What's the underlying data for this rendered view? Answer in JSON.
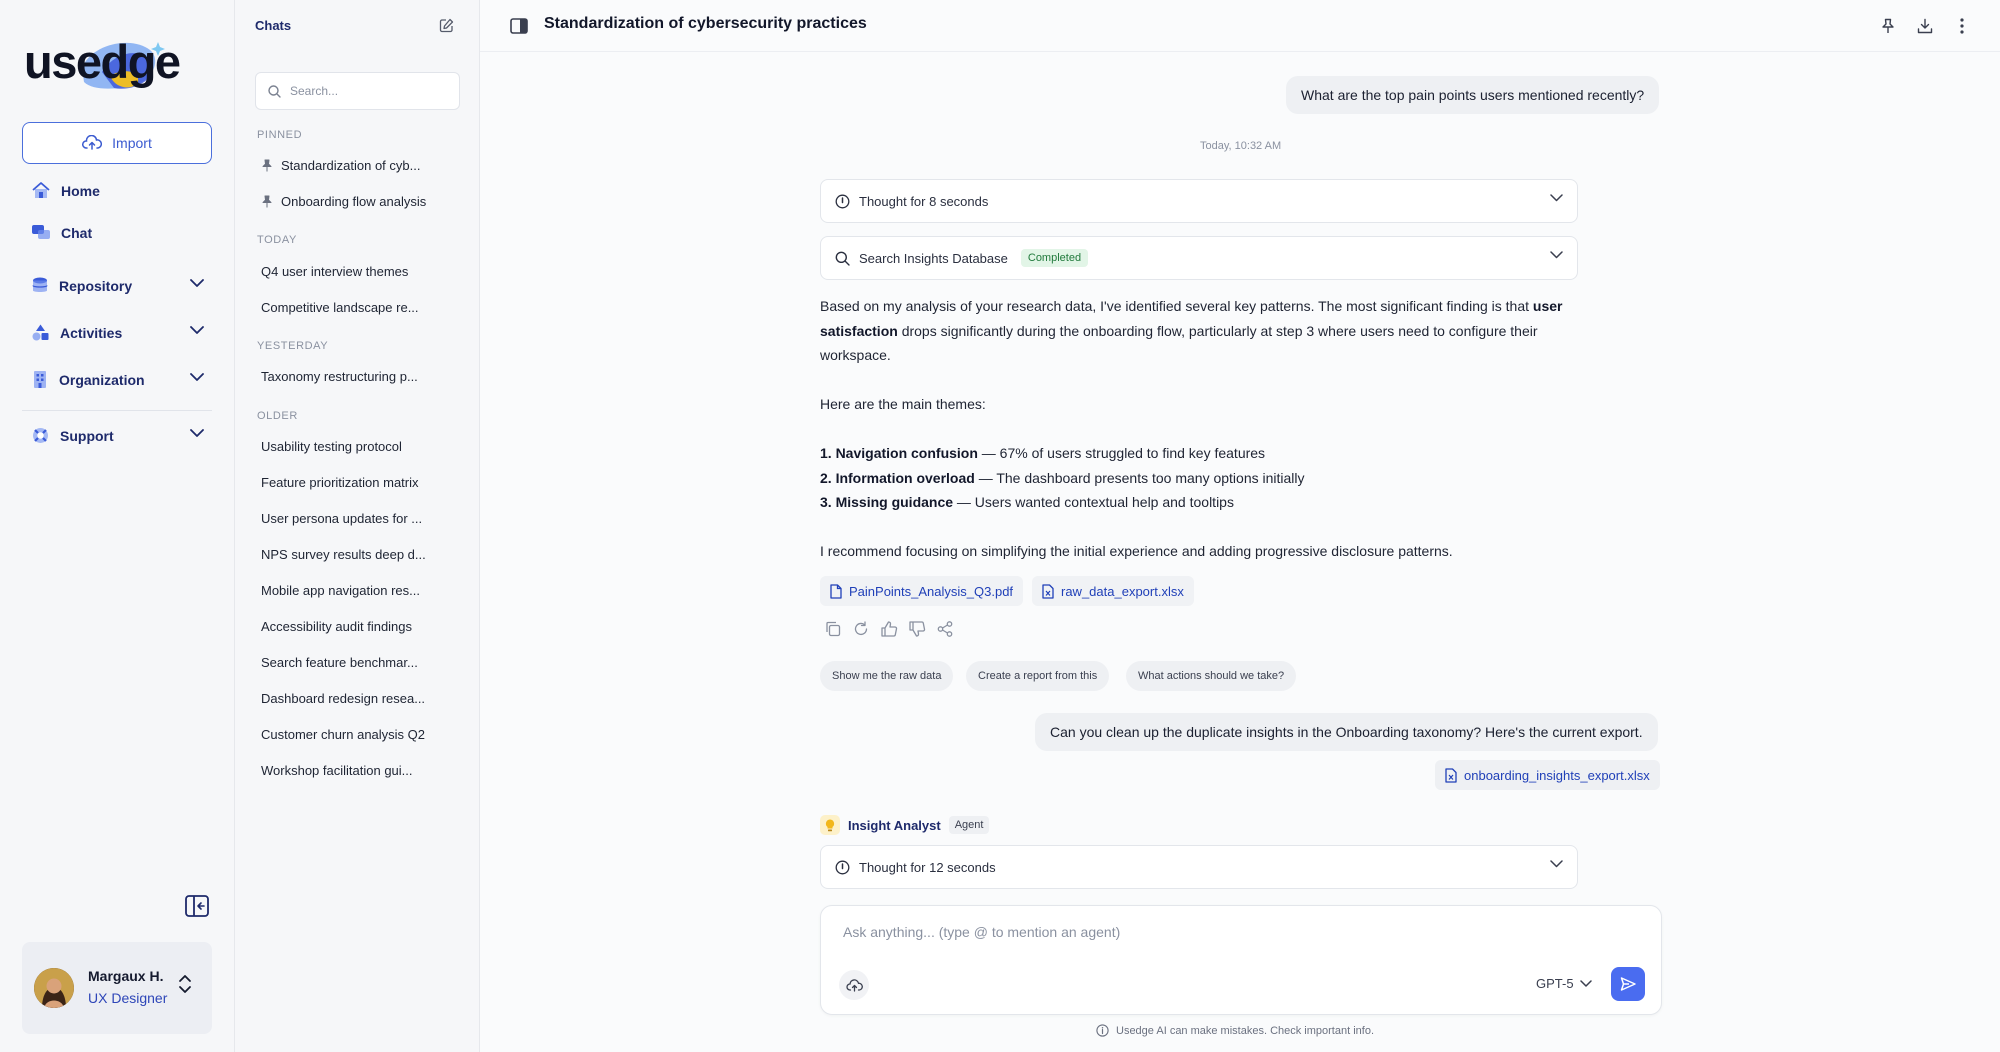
{
  "brand": {
    "logo_text": "usedge"
  },
  "nav": {
    "import_label": "Import",
    "items": [
      {
        "label": "Home",
        "icon": "home-icon"
      },
      {
        "label": "Chat",
        "icon": "chat-icon"
      },
      {
        "label": "Repository",
        "icon": "database-icon"
      },
      {
        "label": "Activities",
        "icon": "shapes-icon"
      },
      {
        "label": "Organization",
        "icon": "building-icon"
      },
      {
        "label": "Support",
        "icon": "lifebuoy-icon"
      }
    ]
  },
  "user": {
    "name": "Margaux H.",
    "role": "UX Designer"
  },
  "chats": {
    "title": "Chats",
    "search_placeholder": "Search...",
    "sections": {
      "pinned": "PINNED",
      "today": "TODAY",
      "yesterday": "YESTERDAY",
      "older": "OLDER"
    },
    "pinned": [
      "Standardization of cyb...",
      "Onboarding flow analysis"
    ],
    "today": [
      "Q4 user interview themes",
      "Competitive landscape re..."
    ],
    "yesterday": [
      "Taxonomy restructuring p..."
    ],
    "older": [
      "Usability testing protocol",
      "Feature prioritization matrix",
      "User persona updates for ...",
      "NPS survey results deep d...",
      "Mobile app navigation res...",
      "Accessibility audit findings",
      "Search feature benchmar...",
      "Dashboard redesign resea...",
      "Customer churn analysis Q2",
      "Workshop facilitation gui..."
    ]
  },
  "conversation": {
    "title": "Standardization of cybersecurity practices",
    "user_message_1": "What are the top pain points users mentioned recently?",
    "timestamp": "Today, 10:32 AM",
    "thought_1": "Thought for 8 seconds",
    "tool_call": "Search Insights Database",
    "tool_status": "Completed",
    "answer": {
      "p1_a": "Based on my analysis of your research data, I've identified several key patterns. The most significant finding is that ",
      "p1_b": "user satisfaction",
      "p1_c": " drops significantly during the onboarding flow, particularly at step 3 where users need to configure their workspace.",
      "p2": "Here are the main themes:",
      "items": [
        {
          "title": "1. Navigation confusion",
          "text": " — 67% of users struggled to find key features"
        },
        {
          "title": "2. Information overload",
          "text": " — The dashboard presents too many options initially"
        },
        {
          "title": "3. Missing guidance",
          "text": " — Users wanted contextual help and tooltips"
        }
      ],
      "p3": "I recommend focusing on simplifying the initial experience and adding progressive disclosure patterns."
    },
    "files": [
      "PainPoints_Analysis_Q3.pdf",
      "raw_data_export.xlsx"
    ],
    "suggestions": [
      "Show me the raw data",
      "Create a report from this",
      "What actions should we take?"
    ],
    "user_message_2": "Can you clean up the duplicate insights in the Onboarding taxonomy? Here's the current export.",
    "user_attachment": "onboarding_insights_export.xlsx",
    "agent_name": "Insight Analyst",
    "agent_tag": "Agent",
    "thought_2": "Thought for 12 seconds"
  },
  "composer": {
    "placeholder": "Ask anything... (type @ to mention an agent)",
    "model": "GPT-5",
    "disclaimer": "Usedge AI can make mistakes. Check important info."
  },
  "colors": {
    "accent": "#4a6cf0",
    "nav_text": "#1e2a6b",
    "success": "#207a3c"
  }
}
